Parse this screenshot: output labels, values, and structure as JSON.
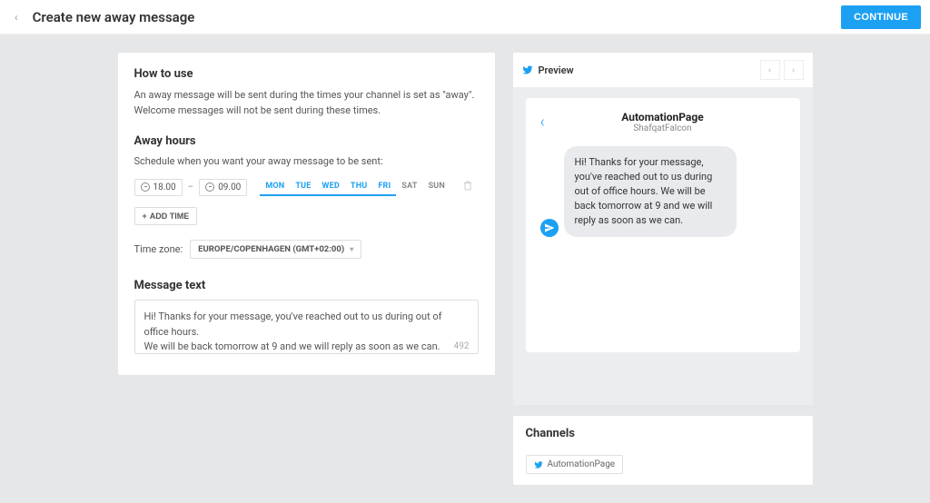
{
  "header": {
    "title": "Create new away message",
    "continue_label": "CONTINUE"
  },
  "form": {
    "how_to_use": {
      "title": "How to use",
      "desc": "An away message will be sent during the times your channel is set as \"away\". Welcome messages will not be sent during these times."
    },
    "away_hours": {
      "title": "Away hours",
      "desc": "Schedule when you want your away message to be sent:",
      "start_time": "18.00",
      "end_time": "09.00",
      "dash": "–",
      "days": [
        {
          "label": "MON",
          "active": true
        },
        {
          "label": "TUE",
          "active": true
        },
        {
          "label": "WED",
          "active": true
        },
        {
          "label": "THU",
          "active": true
        },
        {
          "label": "FRI",
          "active": true
        },
        {
          "label": "SAT",
          "active": false
        },
        {
          "label": "SUN",
          "active": false
        }
      ],
      "add_time_label": "ADD TIME",
      "timezone_label": "Time zone:",
      "timezone_value": "EUROPE/COPENHAGEN (GMT+02:00)"
    },
    "message": {
      "title": "Message text",
      "value": "Hi! Thanks for your message, you've reached out to us during out of office hours.\nWe will be back tomorrow at 9 and we will reply as soon as we can.",
      "remaining": "492"
    }
  },
  "preview": {
    "title": "Preview",
    "page_name": "AutomationPage",
    "handle": "ShafqatFalcon",
    "bubble_text": "Hi! Thanks for your message, you've reached out to us during out of office hours. We will be back tomorrow at 9 and we will reply as soon as we can."
  },
  "channels": {
    "title": "Channels",
    "items": [
      {
        "label": "AutomationPage"
      }
    ]
  }
}
